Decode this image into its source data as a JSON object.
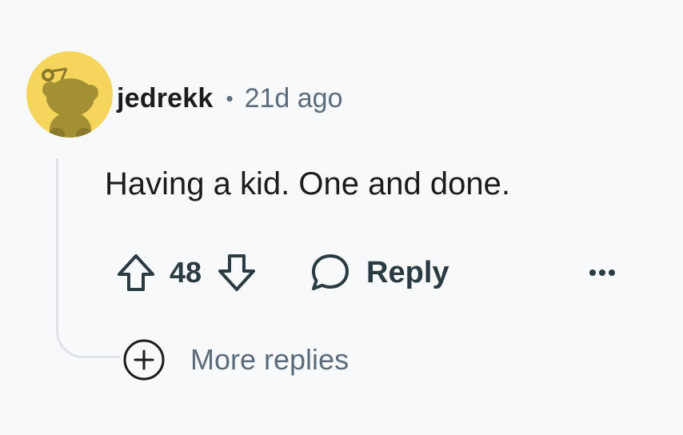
{
  "comment": {
    "avatar_icon": "reddit-snoo-avatar-icon",
    "avatar_color": "#f6d55c",
    "username": "jedrekk",
    "separator": "•",
    "timestamp": "21d ago",
    "body": "Having a kid. One and done.",
    "score": "48",
    "reply_label": "Reply",
    "more_replies_label": "More replies"
  },
  "icons": {
    "upvote": "arrow-up-icon",
    "downvote": "arrow-down-icon",
    "reply": "speech-bubble-icon",
    "overflow": "ellipsis-icon",
    "expand": "plus-circle-icon"
  },
  "colors": {
    "background": "#f8f9fb",
    "text_primary": "#1c1c1c",
    "text_secondary": "#5c6c7a",
    "action_text": "#2a3c42",
    "thread_line": "#dfe3e8"
  }
}
